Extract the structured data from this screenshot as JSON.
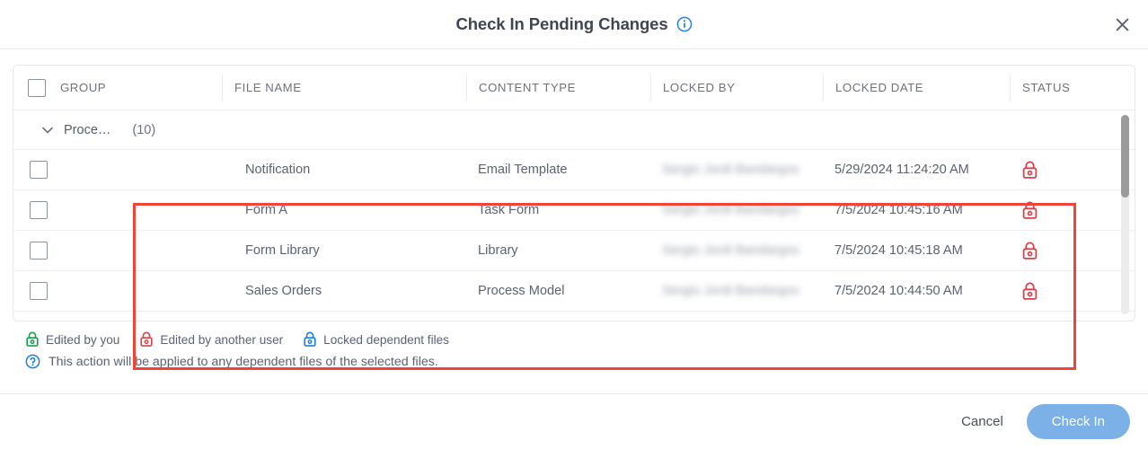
{
  "dialog": {
    "title": "Check In Pending Changes",
    "info_icon": "info-circle-icon",
    "close_icon": "close-icon"
  },
  "table": {
    "columns": [
      {
        "key": "group",
        "label": "GROUP"
      },
      {
        "key": "file",
        "label": "FILE NAME"
      },
      {
        "key": "type",
        "label": "CONTENT TYPE"
      },
      {
        "key": "by",
        "label": "LOCKED BY"
      },
      {
        "key": "date",
        "label": "LOCKED DATE"
      },
      {
        "key": "status",
        "label": "STATUS"
      }
    ],
    "group": {
      "label": "Proce…",
      "count": "(10)",
      "chevron": "chevron-down-icon"
    },
    "rows": [
      {
        "file": "Notification",
        "type": "Email Template",
        "locked_by": "Sergio Jordi Bandargos",
        "locked_date": "5/29/2024 11:24:20 AM",
        "status_icon": "lock-icon-red"
      },
      {
        "file": "Form A",
        "type": "Task Form",
        "locked_by": "Sergio Jordi Bandargos",
        "locked_date": "7/5/2024 10:45:16 AM",
        "status_icon": "lock-icon-red"
      },
      {
        "file": "Form Library",
        "type": "Library",
        "locked_by": "Sergio Jordi Bandargos",
        "locked_date": "7/5/2024 10:45:18 AM",
        "status_icon": "lock-icon-red"
      },
      {
        "file": "Sales Orders",
        "type": "Process Model",
        "locked_by": "Sergio Jordi Bandargos",
        "locked_date": "7/5/2024 10:44:50 AM",
        "status_icon": "lock-icon-red"
      }
    ]
  },
  "legend": [
    {
      "label": "Edited by you",
      "icon": "lock-icon-green",
      "color": "#1a9c4b"
    },
    {
      "label": "Edited by another user",
      "icon": "lock-icon-red",
      "color": "#d8424a"
    },
    {
      "label": "Locked dependent files",
      "icon": "lock-icon-blue",
      "color": "#1f7fe0"
    }
  ],
  "note": {
    "icon": "help-circle-icon",
    "text": "This action will be applied to any dependent files of the selected files."
  },
  "footer": {
    "cancel_label": "Cancel",
    "checkin_label": "Check In"
  },
  "colors": {
    "primary_button": "#7cb1e8",
    "lock_red": "#d8424a",
    "lock_green": "#1a9c4b",
    "lock_blue": "#1f7fe0",
    "info_blue": "#1f7fe0",
    "highlight_box": "#f04438"
  }
}
